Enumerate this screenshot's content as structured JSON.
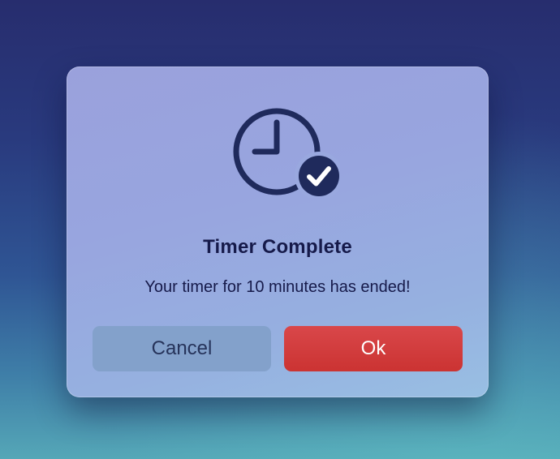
{
  "dialog": {
    "icon": "clock-check-icon",
    "title": "Timer Complete",
    "message": "Your timer for 10 minutes has ended!",
    "cancel_label": "Cancel",
    "ok_label": "Ok"
  },
  "colors": {
    "icon": "#1f2a5c",
    "ok_button": "#d03b3b",
    "cancel_button": "#83a1cb",
    "text": "#161a4a"
  }
}
